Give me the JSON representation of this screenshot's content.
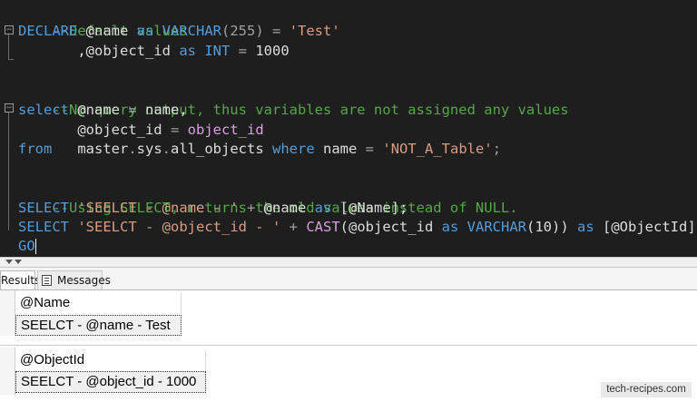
{
  "editor": {
    "line1": "--Default values",
    "line2": {
      "kw1": "DECLARE",
      "v1": " @name ",
      "kw2": "as",
      "sp1": " ",
      "kw3": "VARCHAR",
      "p1": "(255) ",
      "op1": "=",
      "sp2": " ",
      "str1": "'Test'"
    },
    "line3": {
      "pad": "       ,@object_id ",
      "kw1": "as",
      "sp1": " ",
      "kw2": "INT",
      "sp2": " ",
      "op1": "=",
      "rest": " 1000"
    },
    "line5": "--No query output, thus variables are not assigned any values",
    "line6": {
      "kw1": "select",
      "v1": " @name ",
      "op1": "=",
      "v2": " name,"
    },
    "line7": {
      "v1": "       @object_id ",
      "op1": "=",
      "sp1": " ",
      "fn1": "object_id"
    },
    "line8": {
      "kw1": "from",
      "sp1": "   ",
      "fn1": "master",
      "d1": ".",
      "fn2": "sys",
      "d2": ".",
      "v1": "all_objects ",
      "kw2": "where",
      "v2": " name ",
      "op1": "=",
      "sp2": " ",
      "str1": "'NOT_A_Table'",
      "semi": ";"
    },
    "line10": "--Using SELECT, returns the old values instead of NULL.",
    "line11": {
      "kw1": "SELECT",
      "sp1": " ",
      "str1": "'SEELCT - @name - '",
      "sp2": " ",
      "op1": "+",
      "v1": " @name ",
      "kw2": "as",
      "v2": " [@Name];"
    },
    "line12": {
      "kw1": "SELECT",
      "sp1": " ",
      "str1": "'SEELCT - @object_id - '",
      "sp2": " ",
      "op1": "+",
      "sp3": " ",
      "fn1": "CAST",
      "v1": "(@object_id ",
      "kw2": "as",
      "sp4": " ",
      "kw3": "VARCHAR",
      "v2": "(10)) ",
      "kw4": "as",
      "v3": " [@ObjectId];"
    },
    "line13": {
      "kw1": "GO"
    }
  },
  "tabs": {
    "results_label": "Results",
    "messages_label": "Messages"
  },
  "grids": [
    {
      "header": "@Name",
      "value": "SEELCT - @name - Test"
    },
    {
      "header": "@ObjectId",
      "value": "SEELCT - @object_id - 1000"
    }
  ],
  "watermark": "tech-recipes.com",
  "icons": {
    "messages_tab": "messages-icon",
    "fold_toggle": "collapse-icon"
  },
  "colors": {
    "editor_bg": "#1e1e1e",
    "keyword": "#569cd6",
    "comment": "#57a64a",
    "string": "#d69d85",
    "function": "#d8a0df"
  }
}
